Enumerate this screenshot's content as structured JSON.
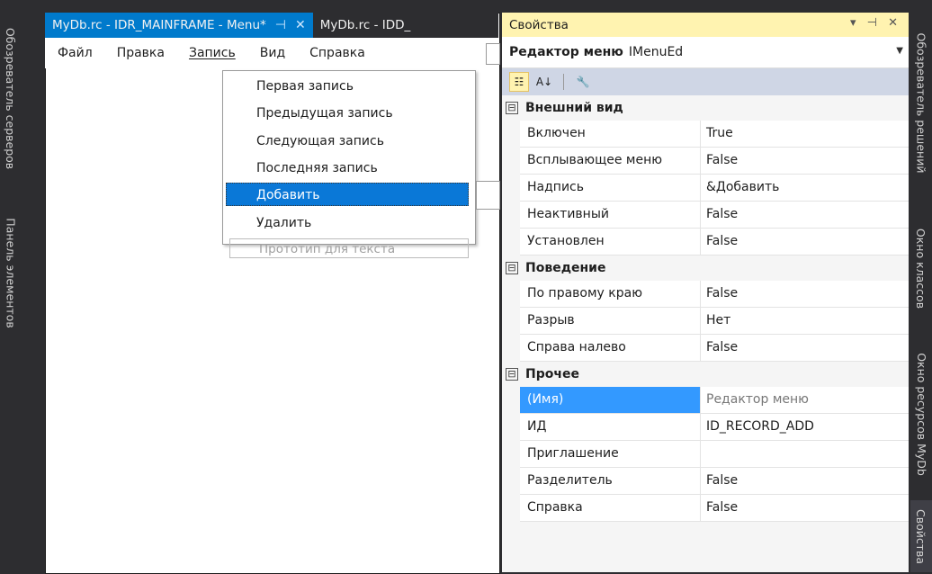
{
  "left_tabs": [
    "Обозреватель серверов",
    "Панель элементов"
  ],
  "right_tabs": [
    "Обозреватель решений",
    "Окно классов",
    "Окно ресурсов MyDb",
    "Свойства"
  ],
  "editor": {
    "tabs": [
      {
        "title": "MyDb.rc - IDR_MAINFRAME - Menu*",
        "pin": "⊣",
        "close": "✕"
      },
      {
        "title": "MyDb.rc - IDD_"
      }
    ],
    "menubar": [
      "Файл",
      "Правка",
      "Запись",
      "Вид",
      "Справка"
    ],
    "dropdown": {
      "items": [
        "Первая запись",
        "Предыдущая запись",
        "Следующая запись",
        "Последняя запись",
        "Добавить",
        "Удалить"
      ],
      "selected_index": 4,
      "placeholder": "Прототип для текста"
    }
  },
  "properties": {
    "title": "Свойства",
    "controls": "▾ ⊣ ✕",
    "object_label": "Редактор меню",
    "object_type": "IMenuEd",
    "categories": [
      {
        "name": "Внешний вид",
        "toggle": "⊟",
        "rows": [
          {
            "name": "Включен",
            "value": "True"
          },
          {
            "name": "Всплывающее меню",
            "value": "False"
          },
          {
            "name": "Надпись",
            "value": "&Добавить"
          },
          {
            "name": "Неактивный",
            "value": "False"
          },
          {
            "name": "Установлен",
            "value": "False"
          }
        ]
      },
      {
        "name": "Поведение",
        "toggle": "⊟",
        "rows": [
          {
            "name": "По правому краю",
            "value": "False"
          },
          {
            "name": "Разрыв",
            "value": "Нет"
          },
          {
            "name": "Справа налево",
            "value": "False"
          }
        ]
      },
      {
        "name": "Прочее",
        "toggle": "⊟",
        "rows": [
          {
            "name": "(Имя)",
            "value": "Редактор меню",
            "selected": true
          },
          {
            "name": "ИД",
            "value": "ID_RECORD_ADD"
          },
          {
            "name": "Приглашение",
            "value": ""
          },
          {
            "name": "Разделитель",
            "value": "False"
          },
          {
            "name": "Справка",
            "value": "False"
          }
        ]
      }
    ]
  },
  "colors": {
    "accent": "#007acc",
    "selection": "#3399ff",
    "title_bar": "#fff3b0"
  }
}
